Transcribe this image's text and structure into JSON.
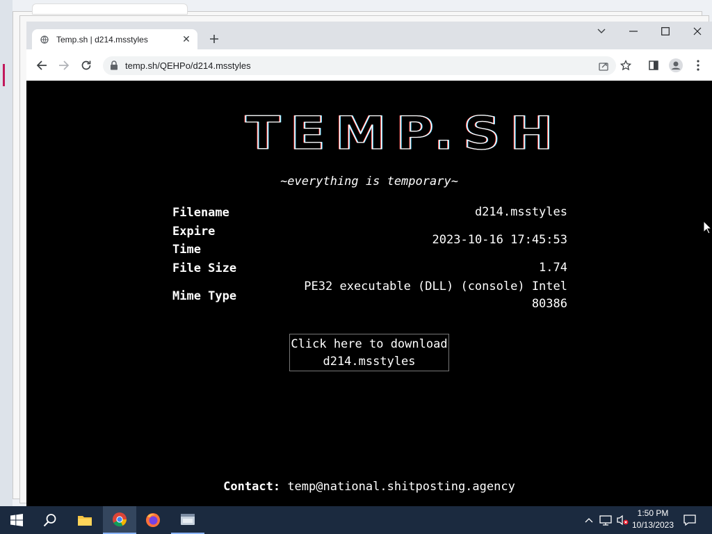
{
  "browser": {
    "tab_title": "Temp.sh | d214.msstyles",
    "url": "temp.sh/QEHPo/d214.msstyles"
  },
  "page": {
    "logo_text": "TEMP.SH",
    "tagline": "~everything is temporary~",
    "fields": {
      "filename_label": "Filename",
      "filename_value": "d214.msstyles",
      "expire_label_1": "Expire",
      "expire_label_2": "Time",
      "expire_value": "2023-10-16 17:45:53",
      "size_label": "File Size",
      "size_value": "1.74",
      "mime_label": "Mime Type",
      "mime_value_1": "PE32 executable (DLL) (console) Intel",
      "mime_value_2": "80386"
    },
    "download_line_1": "Click here to download",
    "download_line_2": "d214.msstyles",
    "contact_label": "Contact:",
    "contact_email": "temp@national.shitposting.agency"
  },
  "taskbar": {
    "time": "1:50 PM",
    "date": "10/13/2023"
  },
  "colors": {
    "page_bg": "#000000",
    "taskbar_bg": "#1b2a3f"
  }
}
